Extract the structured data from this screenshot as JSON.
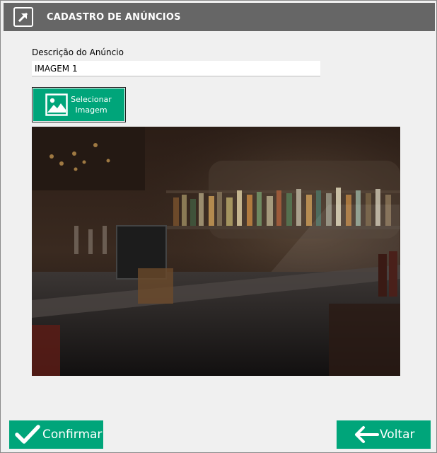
{
  "window": {
    "title": "CADASTRO DE ANÚNCIOS",
    "logo_icon": "arrow-logo-icon"
  },
  "form": {
    "description_label": "Descrição do Anúncio",
    "description_value": "IMAGEM 1",
    "select_image_label_line1": "Selecionar",
    "select_image_label_line2": "Imagem",
    "select_image_icon": "image-icon",
    "preview_image": "bar-interior-photo"
  },
  "footer": {
    "confirm_label": "Confirmar",
    "confirm_icon": "checkmark-icon",
    "back_label": "Voltar",
    "back_icon": "arrow-left-icon"
  },
  "colors": {
    "titlebar": "#666666",
    "accent_green": "#00a57a",
    "background": "#f0f0f0"
  }
}
